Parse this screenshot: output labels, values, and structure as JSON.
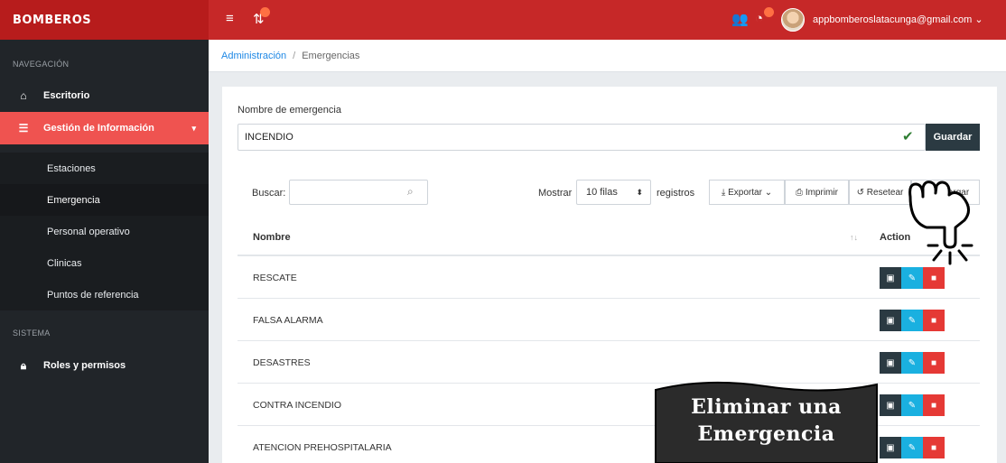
{
  "app": {
    "brand": "BOMBEROS",
    "user_email": "appbomberoslatacunga@gmail.com"
  },
  "colors": {
    "topbar": "#c62828",
    "sidebar": "#212529",
    "active_nav": "#ef5350",
    "dark_button": "#2b3a42",
    "edit_button": "#1ab0e0",
    "delete_button": "#e53935"
  },
  "topbar": {
    "icons": [
      "menu-icon",
      "sync-icon",
      "users-icon",
      "chat-icon"
    ]
  },
  "sidebar": {
    "section_nav": "NAVEGACIÓN",
    "section_system": "SISTEMA",
    "items": [
      {
        "label": "Escritorio",
        "icon": "home-icon"
      },
      {
        "label": "Gestión de Información",
        "icon": "list-icon",
        "active": true
      }
    ],
    "subitems": [
      {
        "label": "Estaciones"
      },
      {
        "label": "Emergencia",
        "current": true
      },
      {
        "label": "Personal operativo"
      },
      {
        "label": "Clinicas"
      },
      {
        "label": "Puntos de referencia"
      }
    ],
    "system_items": [
      {
        "label": "Roles y permisos",
        "icon": "lock-icon"
      }
    ]
  },
  "breadcrumb": {
    "parent": "Administración",
    "separator": "/",
    "current": "Emergencias"
  },
  "form": {
    "label": "Nombre de emergencia",
    "value": "INCENDIO",
    "save_label": "Guardar"
  },
  "table_controls": {
    "search_label": "Buscar:",
    "search_value": "",
    "show_label": "Mostrar",
    "rows_option": "10 filas",
    "records_label": "registros",
    "export_label": "Exportar",
    "print_label": "Imprimir",
    "reset_label": "Resetear",
    "reload_label": "Recargar"
  },
  "table": {
    "columns": [
      "Nombre",
      "Action"
    ],
    "rows": [
      {
        "name": "RESCATE"
      },
      {
        "name": "FALSA ALARMA"
      },
      {
        "name": "DESASTRES"
      },
      {
        "name": "CONTRA INCENDIO"
      },
      {
        "name": "ATENCION PREHOSPITALARIA"
      }
    ]
  },
  "overlay": {
    "line1": "Eliminar una",
    "line2": "Emergencia"
  }
}
